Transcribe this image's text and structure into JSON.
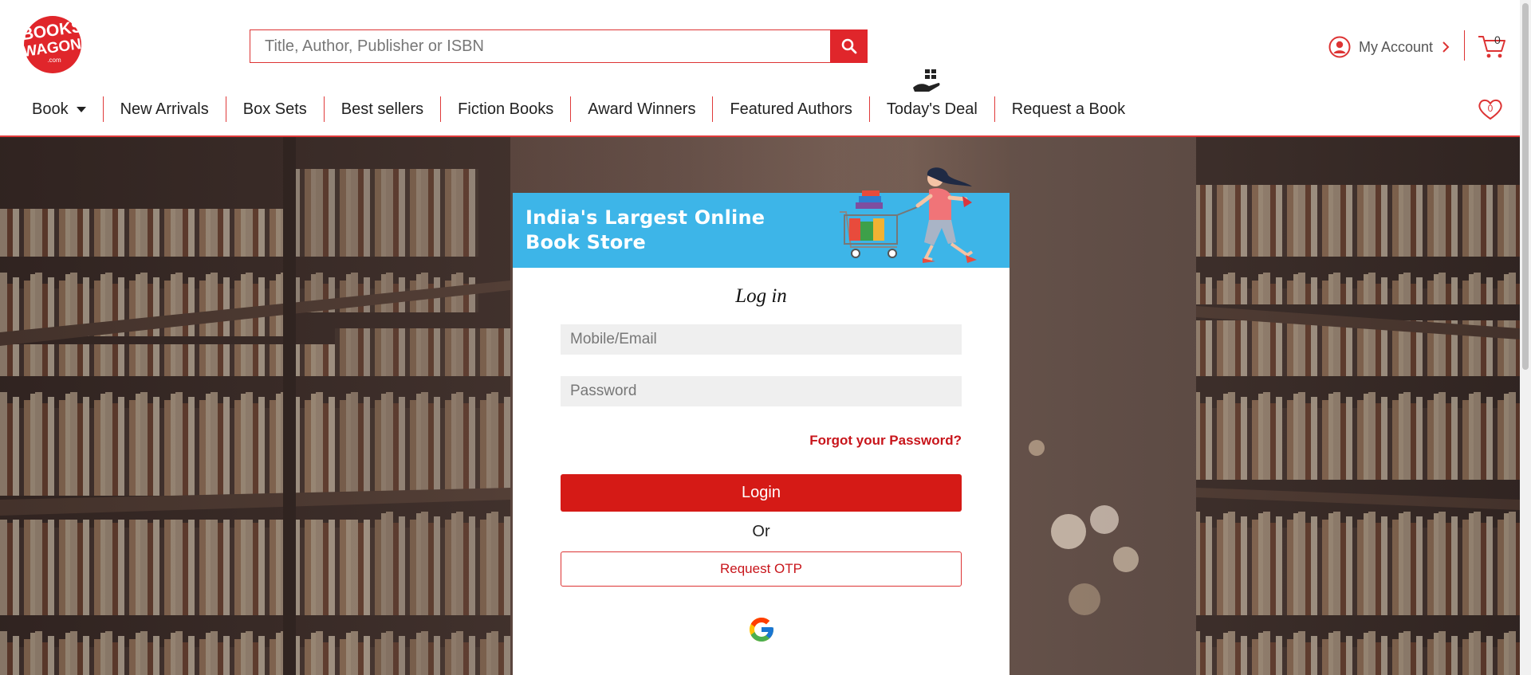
{
  "logo": {
    "line1": "BOOKS",
    "line2": "WAGON",
    "line3": ".com"
  },
  "search": {
    "placeholder": "Title, Author, Publisher or ISBN"
  },
  "account": {
    "label": "My Account"
  },
  "cart": {
    "count": "0"
  },
  "wishlist": {
    "count": "0"
  },
  "nav": {
    "items": [
      "Book",
      "New Arrivals",
      "Box Sets",
      "Best sellers",
      "Fiction Books",
      "Award Winners",
      "Featured Authors",
      "Today's Deal",
      "Request a Book"
    ]
  },
  "banner": {
    "line1": "India's Largest Online",
    "line2": "Book Store"
  },
  "login": {
    "title": "Log in",
    "email_placeholder": "Mobile/Email",
    "password_placeholder": "Password",
    "forgot": "Forgot your Password?",
    "login_label": "Login",
    "or": "Or",
    "otp_label": "Request OTP"
  },
  "colors": {
    "brand_red": "#d51a16",
    "banner_blue": "#3db5e8"
  }
}
